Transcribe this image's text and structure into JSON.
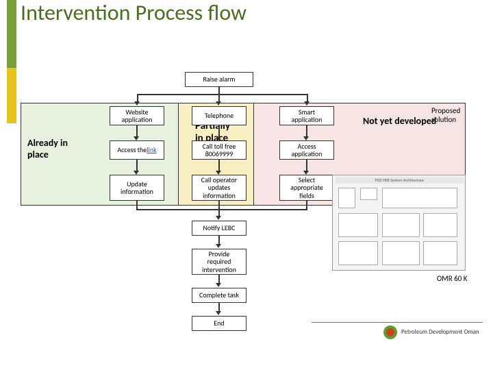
{
  "title": "Intervention Process flow",
  "regions": {
    "already_in_place": "Already in\nplace",
    "partially_in_place": "Partially\nin place",
    "not_yet_developed": "Not yet developed",
    "proposed_solution": "Proposed\nsolution"
  },
  "nodes": {
    "raise_alarm": "Raise alarm",
    "website_app": "Website\napplication",
    "telephone": "Telephone",
    "smart_app": "Smart\napplication",
    "access_link_pre": "Access the ",
    "access_link_link": "link",
    "call_toll": "Call toll free\n80069999",
    "access_app": "Access\napplication",
    "update_info": "Update\ninformation",
    "call_operator": "Call operator\nupdates\ninformation",
    "select_fields": "Select\nappropriate\nfields",
    "notify_lebc": "Notify LEBC",
    "provide_intervention": "Provide\nrequired\nintervention",
    "complete_task": "Complete task",
    "end": "End"
  },
  "cost": "OMR 60 K",
  "company": "Petroleum Development Oman",
  "arch_title": "PSO HER System Architecture"
}
